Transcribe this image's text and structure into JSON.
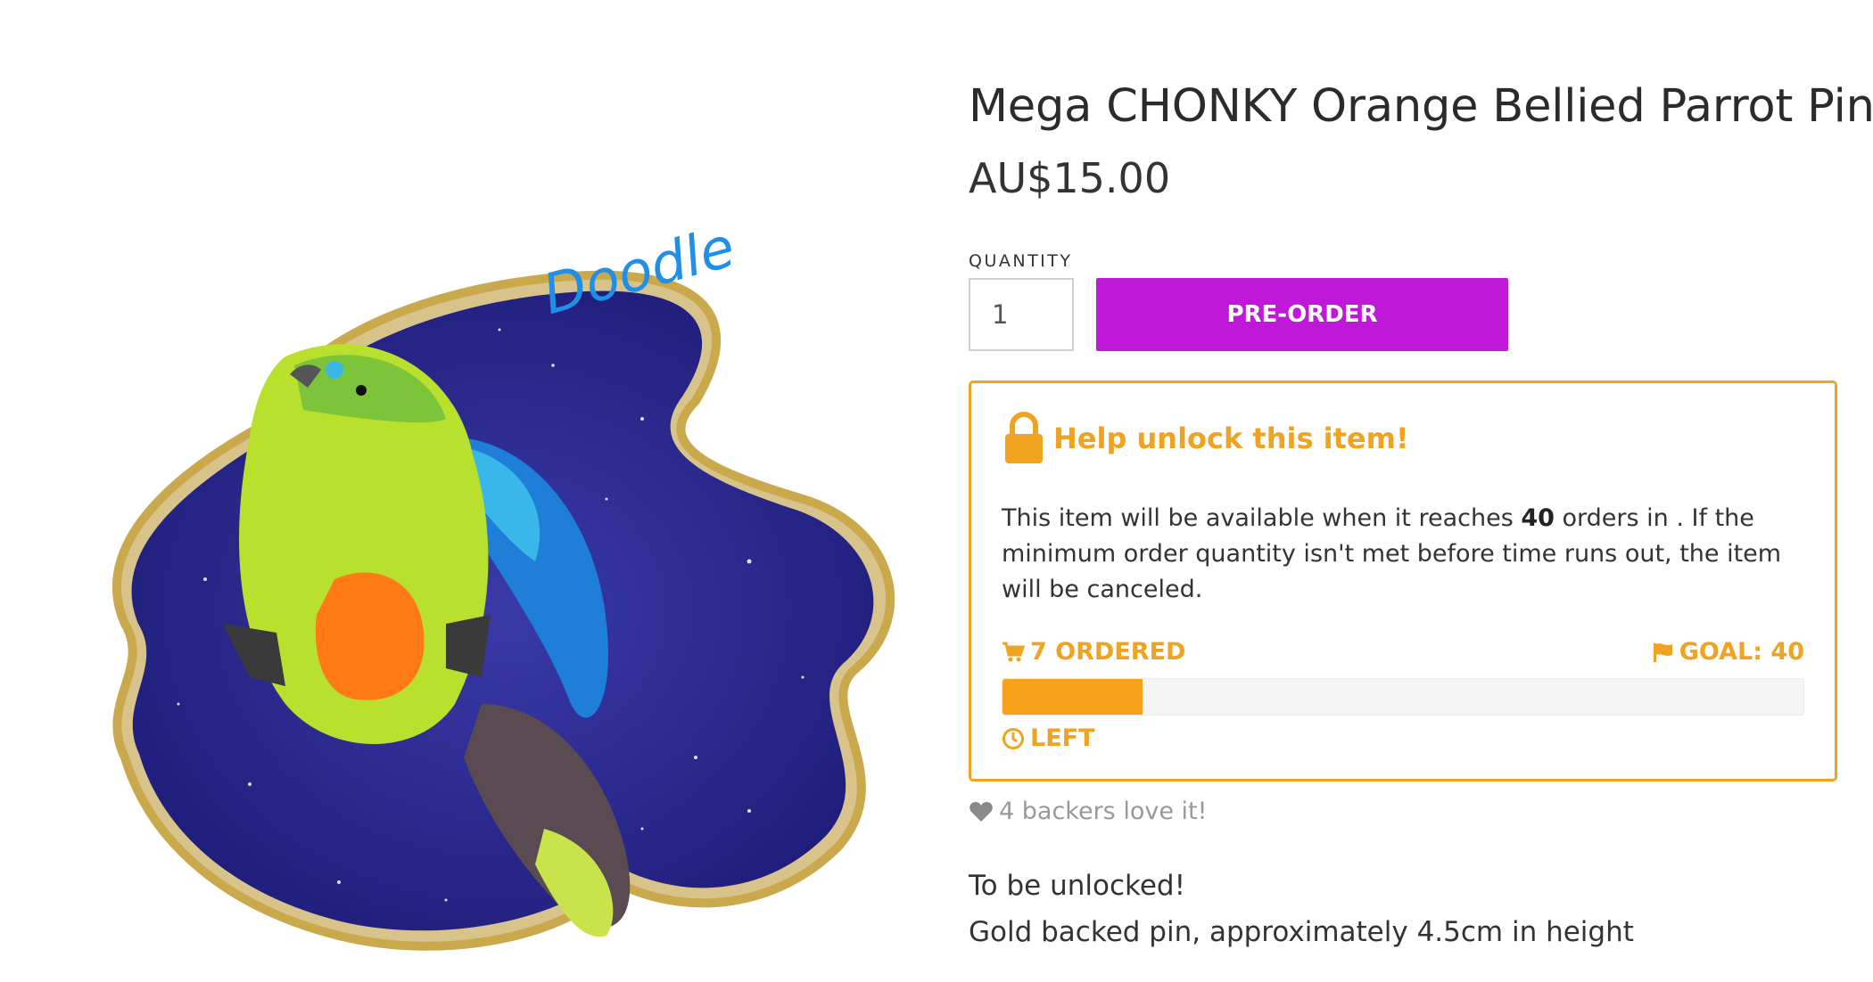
{
  "product": {
    "title": "Mega CHONKY Orange Bellied Parrot Pin",
    "price": "AU$15.00",
    "image_signature": "Doodle"
  },
  "purchase": {
    "quantity_label": "QUANTITY",
    "quantity_value": "1",
    "preorder_label": "PRE-ORDER"
  },
  "unlock": {
    "title": "Help unlock this item!",
    "text_before": "This item will be available when it reaches ",
    "goal_number": "40",
    "text_after": " orders in . If the minimum order quantity isn't met before time runs out, the item will be canceled.",
    "ordered_label": "7 ORDERED",
    "goal_label": "GOAL: 40",
    "left_label": "LEFT",
    "progress_fraction": 0.175
  },
  "backers_text": "4 backers love it!",
  "description": {
    "line1": "To be unlocked!",
    "line2": "Gold backed pin, approximately 4.5cm in height"
  },
  "colors": {
    "accent": "#f0a321",
    "button": "#c018d8",
    "icons": [
      "lock-icon",
      "cart-icon",
      "flag-icon",
      "clock-icon",
      "heart-icon"
    ]
  }
}
